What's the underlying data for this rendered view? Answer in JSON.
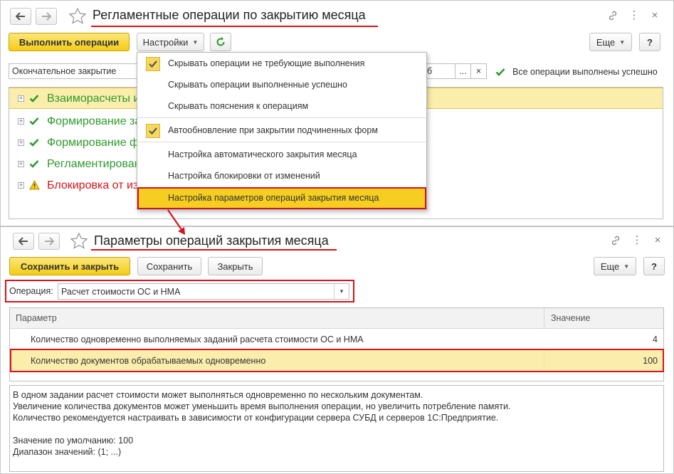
{
  "window1": {
    "title": "Регламентные операции по закрытию месяца",
    "toolbar": {
      "run_label": "Выполнить операции",
      "settings_label": "Настройки",
      "more_label": "Еще",
      "help_label": "?"
    },
    "filter": {
      "mode_value": "Окончательное закрытие",
      "period_fragment": "б",
      "browse_label": "...",
      "clear_label": "×",
      "status_text": "Все операции выполнены успешно"
    },
    "tree": [
      {
        "label": "Взаиморасчеты и",
        "status": "ok"
      },
      {
        "label": "Формирование за",
        "status": "ok"
      },
      {
        "label": "Формирование ф",
        "status": "ok"
      },
      {
        "label": "Регламентирован",
        "status": "ok"
      },
      {
        "label": "Блокировка от из",
        "status": "warning"
      }
    ],
    "menu": {
      "items": [
        {
          "label": "Скрывать операции не требующие выполнения",
          "checked": true
        },
        {
          "label": "Скрывать операции выполненные успешно",
          "checked": false
        },
        {
          "label": "Скрывать пояснения к операциям",
          "checked": false
        },
        {
          "label": "Автообновление при закрытии подчиненных форм",
          "checked": true
        },
        {
          "label": "Настройка автоматического закрытия месяца",
          "checked": false
        },
        {
          "label": "Настройка блокировки от изменений",
          "checked": false
        },
        {
          "label": "Настройка параметров операций закрытия месяца",
          "checked": false,
          "highlighted": true
        }
      ]
    }
  },
  "window2": {
    "title": "Параметры операций закрытия месяца",
    "toolbar": {
      "save_close_label": "Сохранить и закрыть",
      "save_label": "Сохранить",
      "close_label": "Закрыть",
      "more_label": "Еще",
      "help_label": "?"
    },
    "operation": {
      "label": "Операция:",
      "value": "Расчет стоимости ОС и НМА"
    },
    "table": {
      "columns": [
        "Параметр",
        "Значение"
      ],
      "rows": [
        {
          "param": "Количество одновременно выполняемых заданий расчета стоимости ОС и НМА",
          "value": "4"
        },
        {
          "param": "Количество документов обрабатываемых одновременно",
          "value": "100"
        }
      ]
    },
    "description": [
      "В одном задании расчет стоимости может выполняться одновременно по нескольким документам.",
      "Увеличение количества документов может уменьшить время выполнения операции, но увеличить потребление памяти.",
      "Количество рекомендуется настраивать в зависимости от конфигурации сервера СУБД и серверов 1С:Предприятие.",
      "",
      "Значение по умолчанию: 100",
      "Диапазон значений: (1; ...)"
    ]
  },
  "colors": {
    "accent_yellow": "#f5cc16",
    "highlight_red": "#d4141c",
    "ok_green": "#2d9a2d",
    "selection": "#fbeeac"
  }
}
